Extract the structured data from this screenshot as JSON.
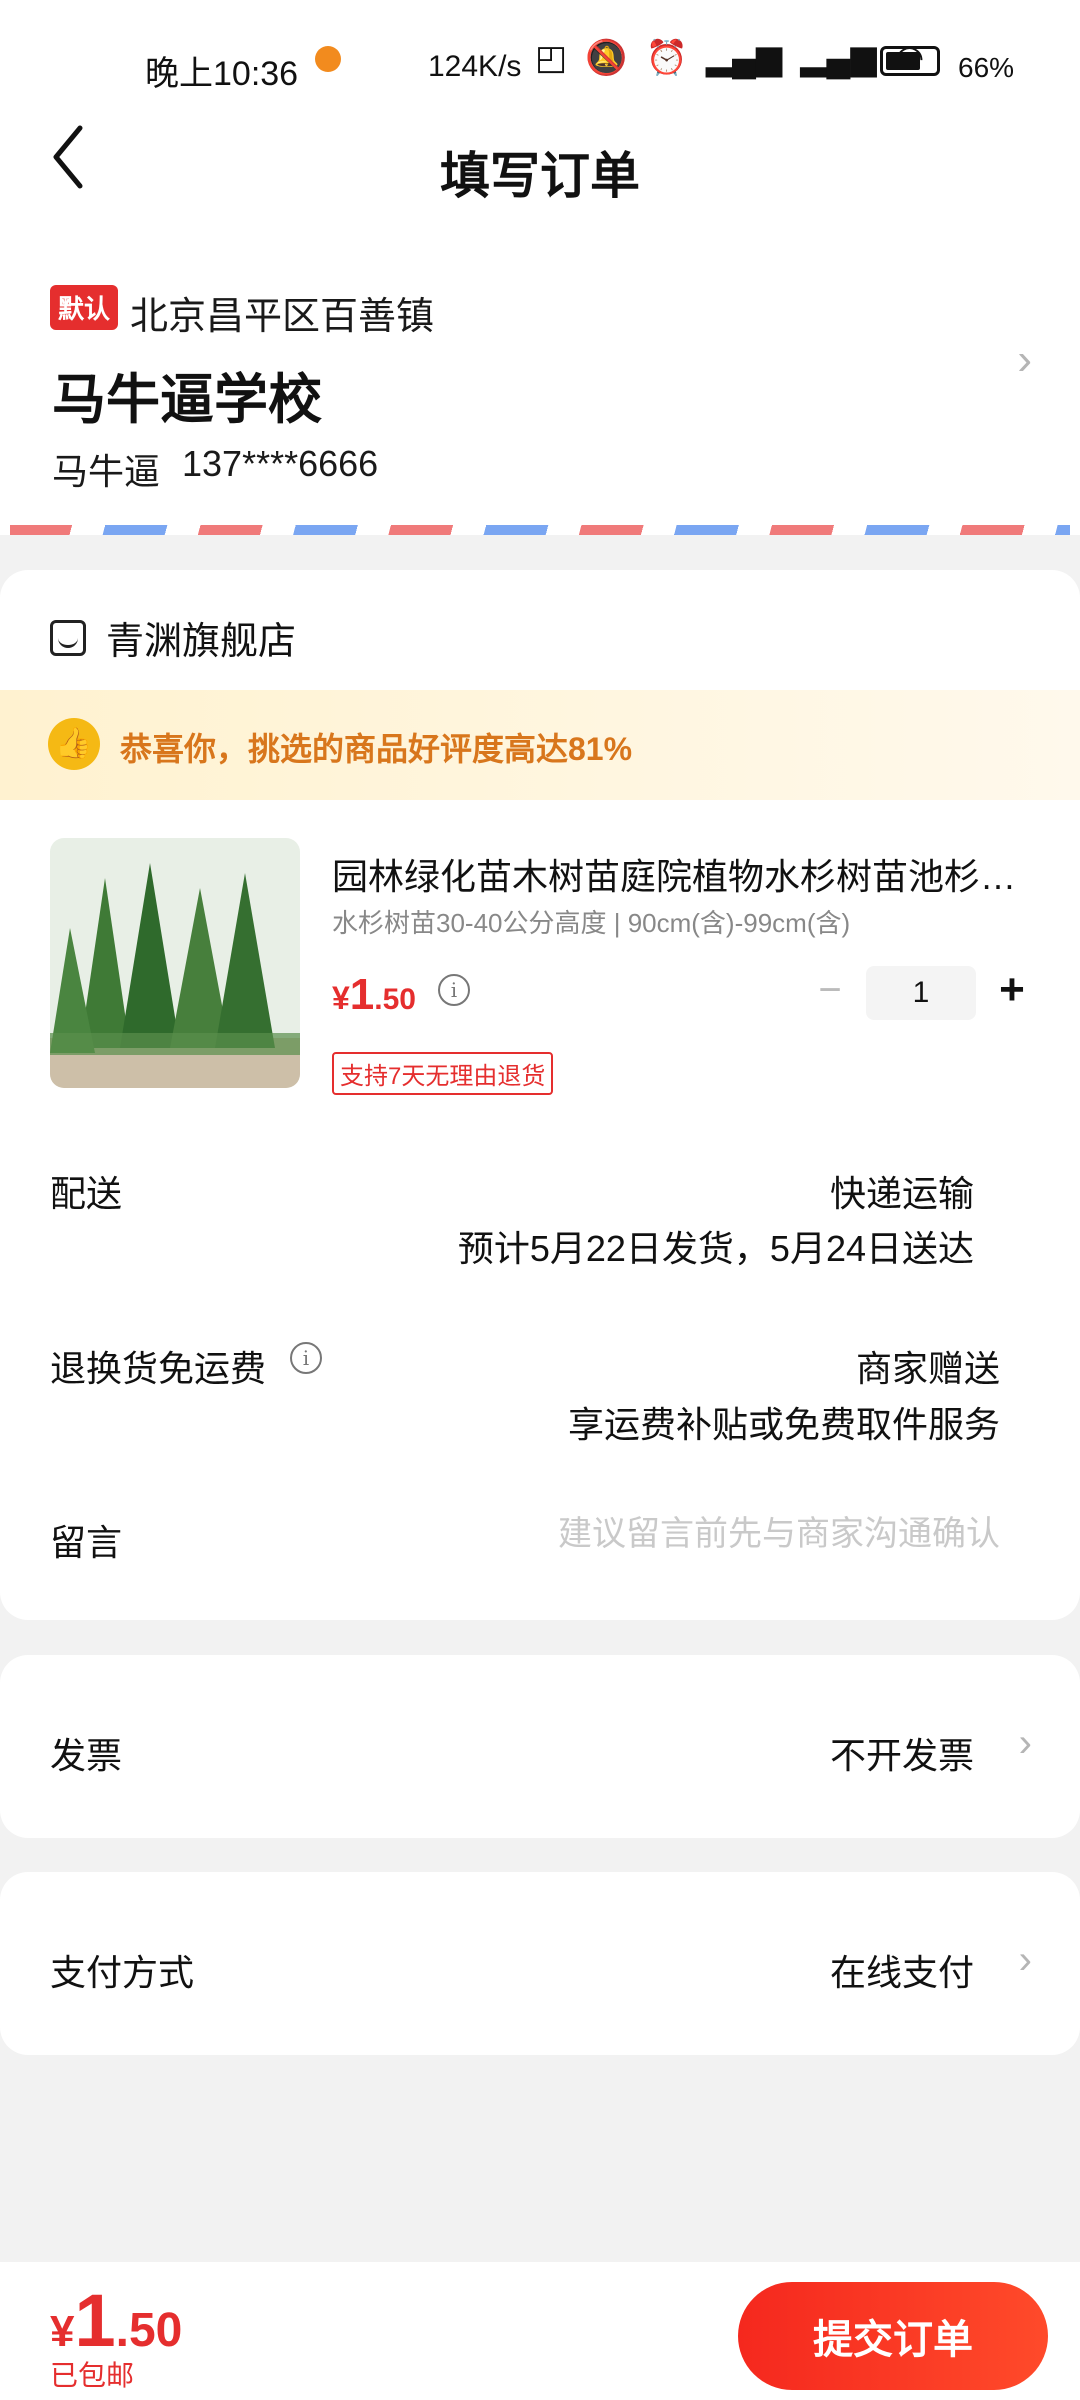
{
  "status_bar": {
    "time": "晚上10:36",
    "net_speed": "124K/s",
    "icons": [
      "nfc-icon",
      "mute-icon",
      "alarm-icon",
      "signal-hd-icon",
      "signal-hd-icon",
      "wifi-icon",
      "battery-icon"
    ],
    "battery": "66%"
  },
  "header": {
    "title": "填写订单"
  },
  "address": {
    "badge": "默认",
    "region": "北京昌平区百善镇",
    "detail": "马牛逼学校",
    "name": "马牛逼",
    "phone": "137****6666"
  },
  "store": {
    "name": "青渊旗舰店",
    "promo": "恭喜你，挑选的商品好评度高达81%",
    "product": {
      "title": "园林绿化苗木树苗庭院植物水杉树苗池杉…",
      "spec": "水杉树苗30-40公分高度 | 90cm(含)-99cm(含)",
      "price_currency": "¥",
      "price_int": "1",
      "price_dec": ".50",
      "quantity": "1",
      "minus": "−",
      "plus": "+",
      "tag": "支持7天无理由退货"
    },
    "shipping": {
      "label": "配送",
      "method": "快递运输",
      "eta": "预计5月22日发货，5月24日送达"
    },
    "return_shipping": {
      "label": "退换货免运费",
      "value": "商家赠送",
      "desc": "享运费补贴或免费取件服务"
    },
    "message": {
      "label": "留言",
      "placeholder": "建议留言前先与商家沟通确认"
    }
  },
  "invoice": {
    "label": "发票",
    "value": "不开发票"
  },
  "payment": {
    "label": "支付方式",
    "value": "在线支付"
  },
  "bottom": {
    "currency": "¥",
    "total_int": "1",
    "total_dec": ".50",
    "shipping_note": "已包邮",
    "submit": "提交订单"
  },
  "colors": {
    "accent": "#e52e2e",
    "promo_text": "#d8761c",
    "promo_bg": "#fff2d0"
  }
}
